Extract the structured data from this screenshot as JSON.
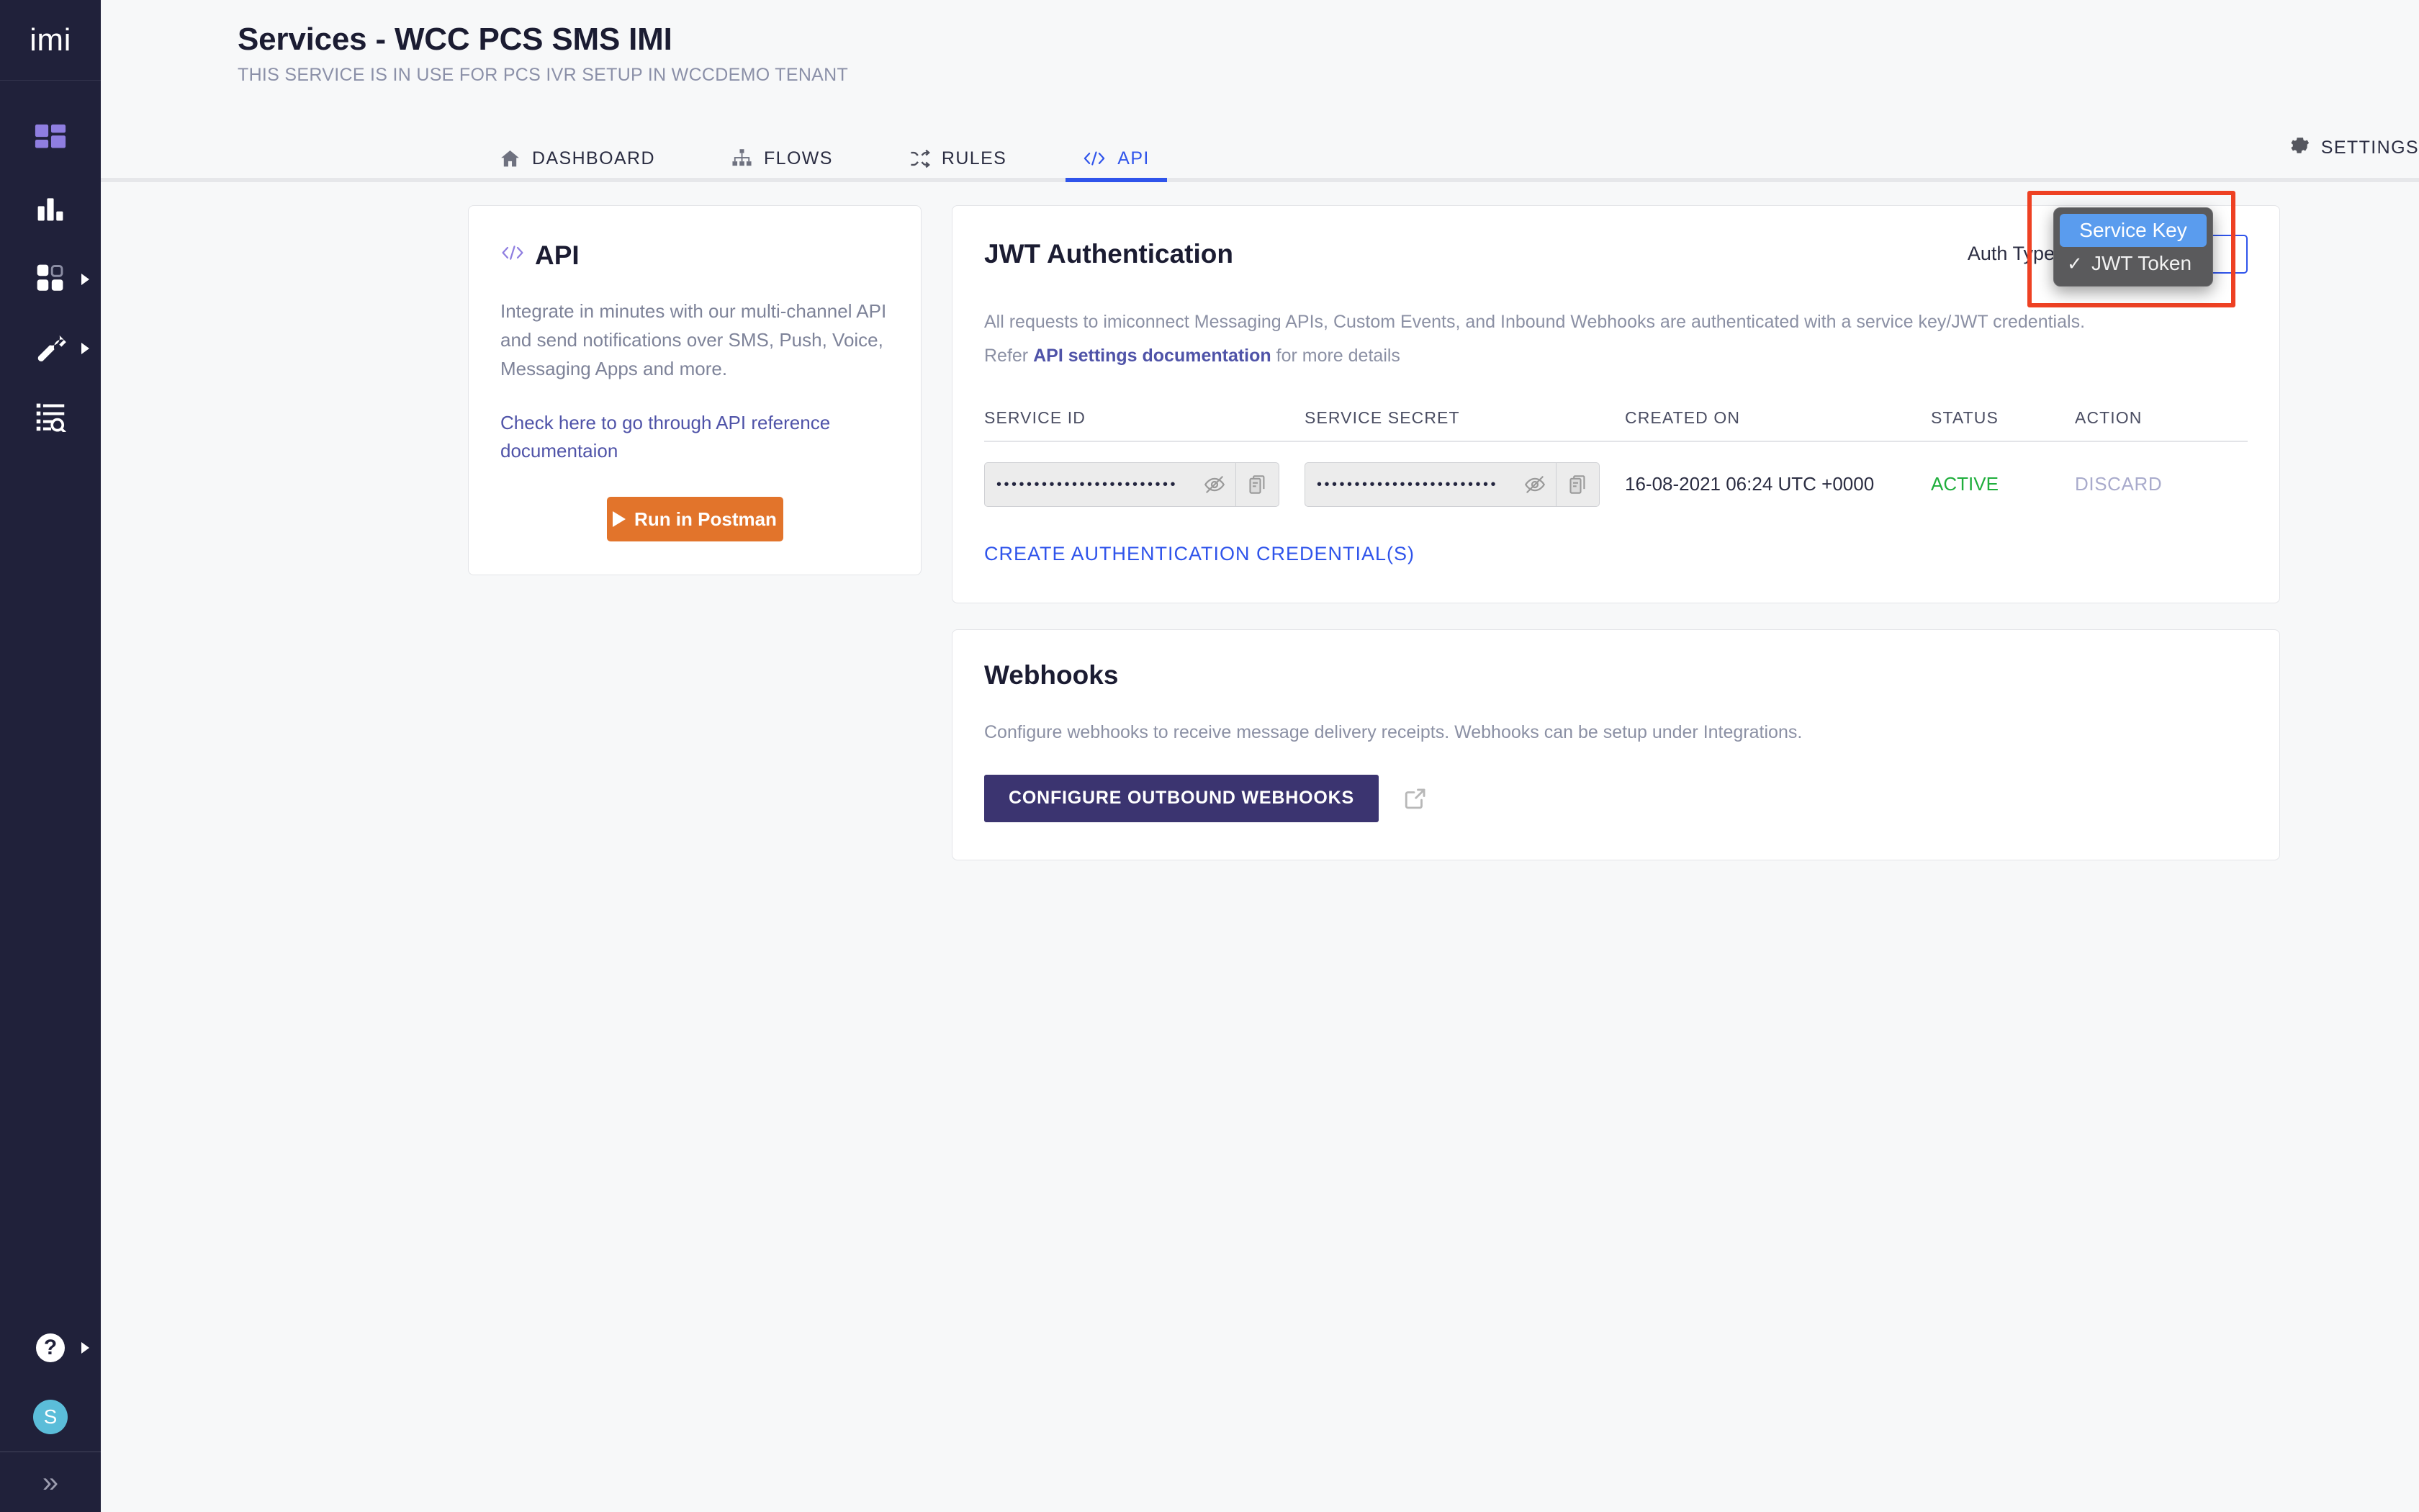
{
  "sidebar": {
    "logo": "imi",
    "items": [
      {
        "name": "dashboard-grid",
        "icon": "grid-purple-icon",
        "has_caret": false
      },
      {
        "name": "analytics",
        "icon": "bar-chart-icon",
        "has_caret": false
      },
      {
        "name": "apps",
        "icon": "apps-grid-icon",
        "has_caret": true
      },
      {
        "name": "tools",
        "icon": "wrench-icon",
        "has_caret": true
      },
      {
        "name": "logs",
        "icon": "list-search-icon",
        "has_caret": false
      }
    ],
    "help_glyph": "?",
    "avatar_initial": "S",
    "collapse_glyph": "»"
  },
  "header": {
    "title": "Services - WCC PCS SMS IMI",
    "subtitle": "THIS SERVICE IS IN USE FOR PCS IVR SETUP IN WCCDEMO TENANT"
  },
  "tabs": [
    {
      "label": "DASHBOARD",
      "icon": "home-icon",
      "active": false
    },
    {
      "label": "FLOWS",
      "icon": "flow-tree-icon",
      "active": false
    },
    {
      "label": "RULES",
      "icon": "shuffle-icon",
      "active": false
    },
    {
      "label": "API",
      "icon": "code-icon",
      "active": true
    }
  ],
  "settings_tab": {
    "label": "SETTINGS",
    "icon": "gear-icon"
  },
  "api_card": {
    "title": "API",
    "icon": "code-icon",
    "body": "Integrate in minutes with our multi-channel API and send notifications over SMS, Push, Voice, Messaging Apps and more.",
    "link": "Check here to go through API reference documentaion",
    "button": "Run in Postman"
  },
  "jwt": {
    "title": "JWT Authentication",
    "auth_type_label": "Auth Type",
    "auth_type_value": "JWT Token",
    "description_line1": "All requests to imiconnect Messaging APIs, Custom Events, and Inbound Webhooks are authenticated with a service key/JWT credentials.",
    "description_refer": "Refer ",
    "description_link": "API settings documentation",
    "description_tail": " for more details",
    "columns": [
      "SERVICE ID",
      "SERVICE SECRET",
      "CREATED ON",
      "STATUS",
      "ACTION"
    ],
    "rows": [
      {
        "service_id": "••••••••••••••••••••••••",
        "service_secret": "••••••••••••••••••••••••",
        "created_on": "16-08-2021 06:24 UTC +0000",
        "status": "ACTIVE",
        "action": "DISCARD"
      }
    ],
    "create_link": "CREATE AUTHENTICATION CREDENTIAL(S)"
  },
  "webhooks": {
    "title": "Webhooks",
    "description": "Configure webhooks to receive message delivery receipts. Webhooks can be setup under Integrations.",
    "button": "CONFIGURE OUTBOUND WEBHOOKS",
    "external_icon": "external-link-icon"
  },
  "dropdown": {
    "options": [
      {
        "label": "Service Key",
        "checked": false,
        "highlighted": true
      },
      {
        "label": "JWT Token",
        "checked": true,
        "highlighted": false
      }
    ],
    "check_glyph": "✓"
  },
  "colors": {
    "sidebar_bg": "#20213a",
    "accent_blue": "#2f54eb",
    "purple": "#8f7ee0",
    "orange": "#e2742b",
    "status_green": "#1fae3c",
    "webhook_btn": "#3b3470",
    "highlight_red": "#ee4123",
    "menu_highlight": "#5a9cee"
  }
}
